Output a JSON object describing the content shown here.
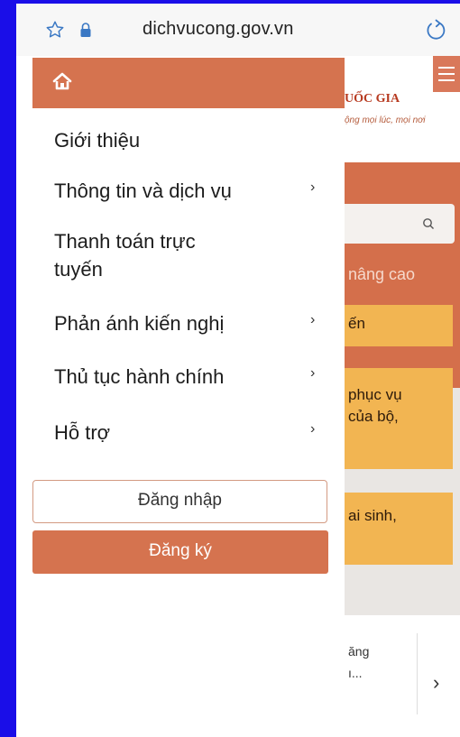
{
  "browser": {
    "url": "dichvucong.gov.vn",
    "icons": [
      "star-icon",
      "lock-icon",
      "reload-icon"
    ]
  },
  "background_page": {
    "site_title_fragment": "UỐC GIA",
    "site_tagline_fragment": "ộng mọi lúc, mọi nơi",
    "advanced_search_fragment": "nâng cao",
    "cards": [
      "ến",
      "phục vụ\ncủa bộ,",
      "ai sinh,"
    ],
    "bottom_text": "ăng\nı...",
    "bottom_arrow": "›"
  },
  "drawer": {
    "home_icon": "home-icon",
    "menu": [
      {
        "label": "Giới thiệu",
        "has_submenu": false
      },
      {
        "label": "Thông tin và dịch vụ",
        "has_submenu": true
      },
      {
        "label": "Thanh toán trực\ntuyến",
        "has_submenu": false
      },
      {
        "label": "Phản ánh kiến nghị",
        "has_submenu": true
      },
      {
        "label": "Thủ tục hành chính",
        "has_submenu": true
      },
      {
        "label": "Hỗ trợ",
        "has_submenu": true
      }
    ],
    "chevron": "›",
    "login_label": "Đăng nhập",
    "register_label": "Đăng ký"
  },
  "colors": {
    "accent": "#d5734f",
    "frame": "#1a0ee8"
  }
}
